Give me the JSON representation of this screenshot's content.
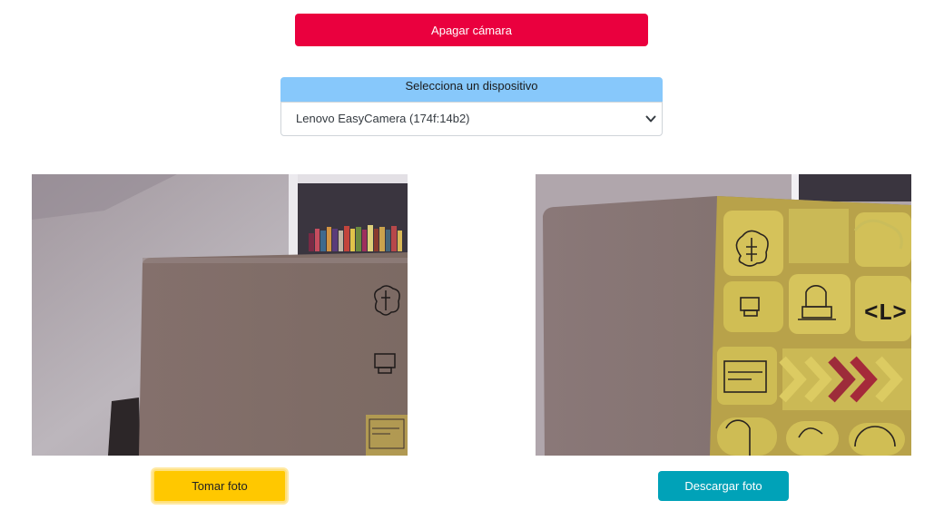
{
  "controls": {
    "camera_toggle_label": "Apagar cámara",
    "device_selector_title": "Selecciona un dispositivo",
    "selected_device": "Lenovo EasyCamera (174f:14b2)"
  },
  "actions": {
    "take_photo_label": "Tomar foto",
    "download_photo_label": "Descargar foto"
  },
  "colors": {
    "camera_toggle": "#ea003e",
    "device_header": "#87c8fb",
    "take_photo": "#ffc800",
    "download_photo": "#00a2b8"
  }
}
